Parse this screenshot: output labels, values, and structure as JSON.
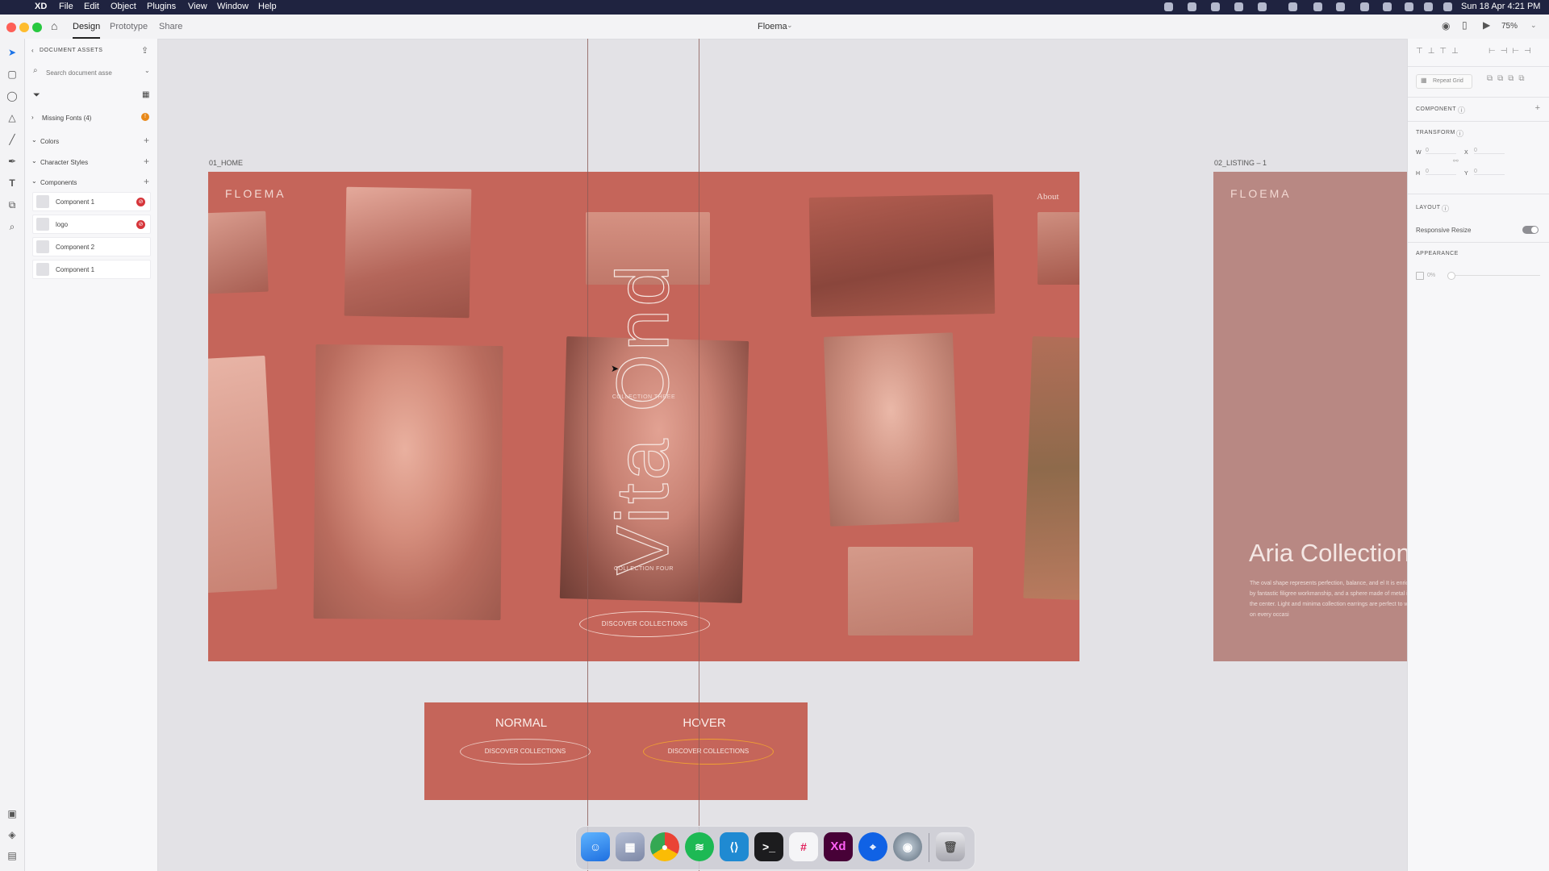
{
  "menubar": {
    "app_name": "XD",
    "menus": [
      "File",
      "Edit",
      "Object",
      "Plugins",
      "View",
      "Window",
      "Help"
    ],
    "datetime": "Sun 18 Apr  4:21 PM"
  },
  "titlebar": {
    "tabs": [
      "Design",
      "Prototype",
      "Share"
    ],
    "document_title": "Floema",
    "zoom": "75%"
  },
  "assets": {
    "header": "DOCUMENT ASSETS",
    "search_placeholder": "Search document asse",
    "missing_fonts": "Missing Fonts (4)",
    "sections": [
      "Colors",
      "Character Styles",
      "Components"
    ],
    "components": [
      "Component 1",
      "logo",
      "Component 2",
      "Component 1"
    ]
  },
  "inspector": {
    "repeat_grid": "Repeat Grid",
    "component": "COMPONENT",
    "transform": "TRANSFORM",
    "w_label": "W",
    "w_value": "0",
    "x_label": "X",
    "x_value": "0",
    "h_label": "H",
    "h_value": "0",
    "y_label": "Y",
    "y_value": "0",
    "layout": "LAYOUT",
    "responsive_resize": "Responsive Resize",
    "appearance": "APPEARANCE",
    "opacity": "0%"
  },
  "canvas": {
    "artboard_home_label": "01_HOME",
    "artboard_listing_label": "02_LISTING – 1",
    "home": {
      "brand": "FLOEMA",
      "nav_about": "About",
      "hero_title": "Vita Ond",
      "collection_three": "COLLECTION THREE",
      "collection_four": "COLLECTION FOUR",
      "cta": "DISCOVER COLLECTIONS"
    },
    "listing": {
      "brand": "FLOEMA",
      "title": "Aria Collection",
      "body": "The oval shape represents perfection, balance, and el It is enriched by fantastic filigree workmanship, and a sphere made of metal in the center. Light and minima collection earrings are perfect to wear on every occasi"
    },
    "states": {
      "normal": "NORMAL",
      "hover": "HOVER",
      "normal_button": "DISCOVER COLLECTIONS",
      "hover_button": "DISCOVER COLLECTIONS"
    }
  },
  "dock_apps": [
    "Finder",
    "Launchpad",
    "Chrome",
    "Spotify",
    "VS Code",
    "Terminal",
    "Slack",
    "Adobe XD",
    "Maps",
    "QuickTime",
    "Trash"
  ]
}
